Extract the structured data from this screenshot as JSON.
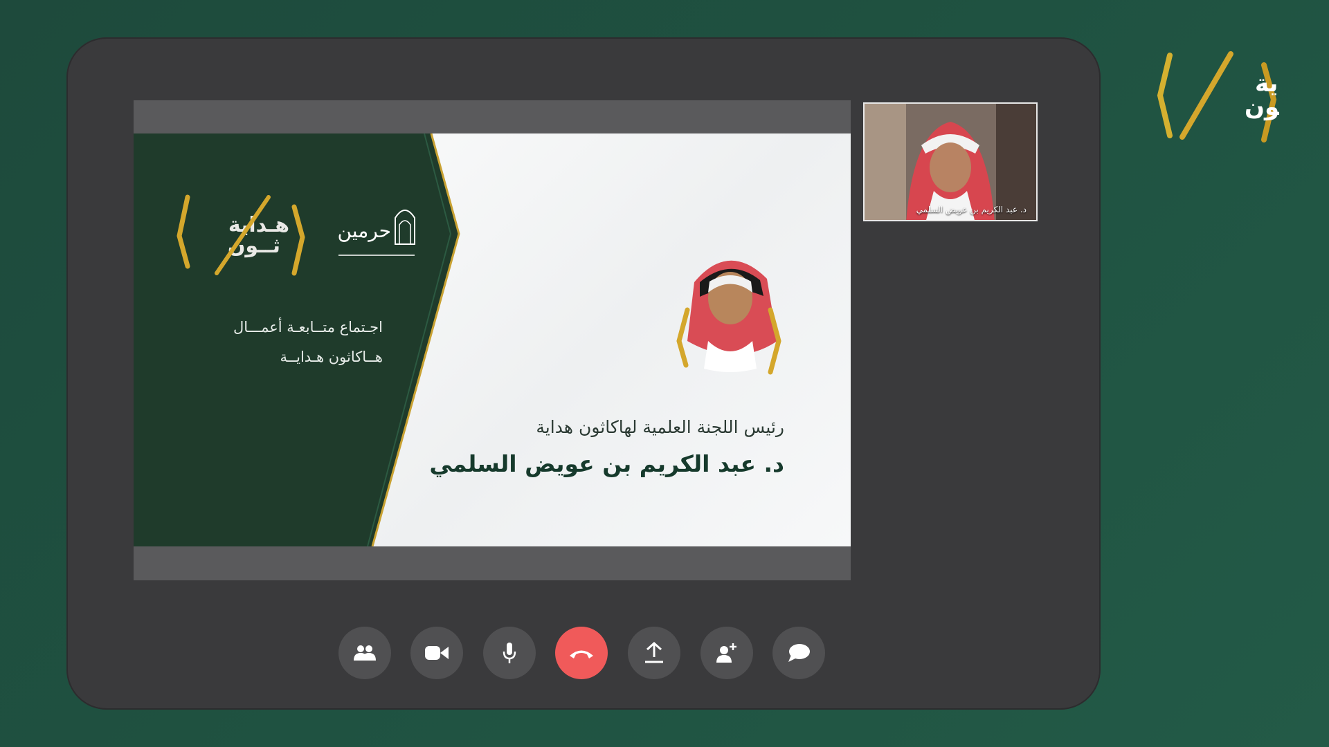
{
  "brand": {
    "logo_text_line1": "هـداية",
    "logo_text_line2": "ثــون",
    "accent_color": "#d4a72c"
  },
  "slide": {
    "partner_logo_text": "حرمين",
    "meeting_title_line1": "اجـتماع متــابعـة أعمـــال",
    "meeting_title_line2": "هــاكاثون هـدايــة",
    "speaker_role": "رئيس اللجنة العلمية لهاكاثون هداية",
    "speaker_name": "د. عبد الكريم بن عويض السلمي",
    "panel_color": "#1f3b2b"
  },
  "participant_thumbnail": {
    "name_label": "د. عبد الكريم بن عويض السلمي"
  },
  "controls": [
    {
      "name": "participants-button",
      "icon": "people-icon"
    },
    {
      "name": "camera-button",
      "icon": "video-camera-icon"
    },
    {
      "name": "microphone-button",
      "icon": "microphone-icon"
    },
    {
      "name": "end-call-button",
      "icon": "phone-hangup-icon",
      "color": "#f05a5a"
    },
    {
      "name": "share-screen-button",
      "icon": "upload-icon"
    },
    {
      "name": "add-participant-button",
      "icon": "add-user-icon"
    },
    {
      "name": "chat-button",
      "icon": "chat-bubble-icon"
    }
  ]
}
